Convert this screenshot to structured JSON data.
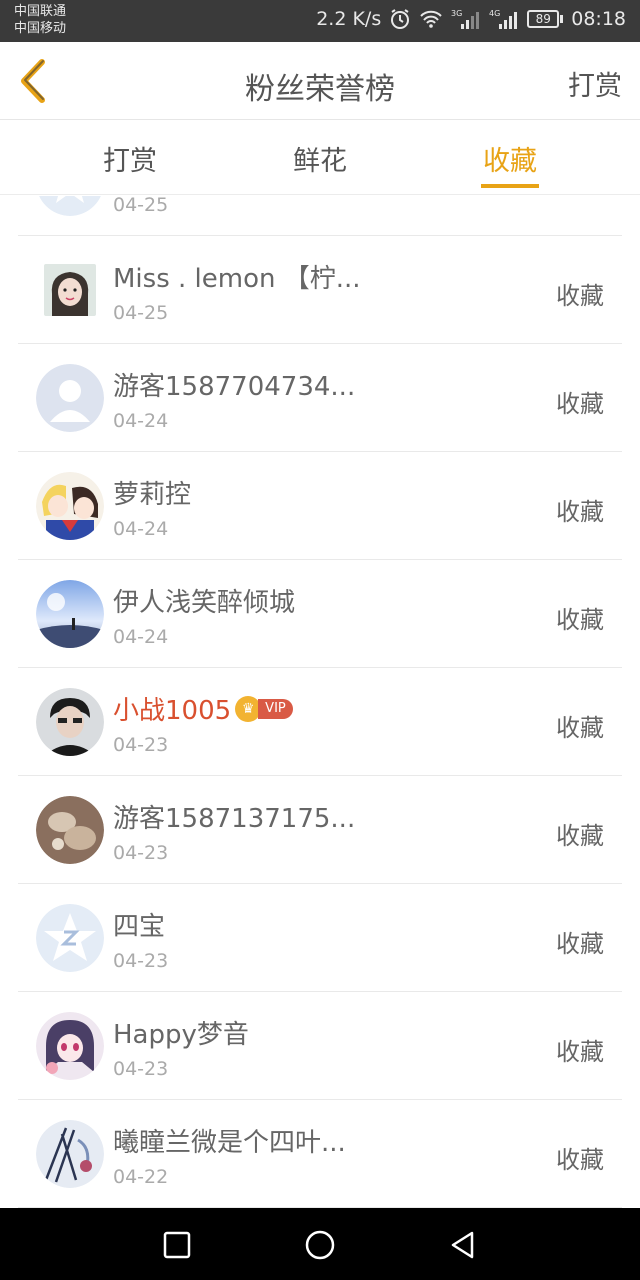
{
  "status_bar": {
    "carrier1": "中国联通",
    "carrier2": "中国移动",
    "speed": "2.2 K/s",
    "net1": "3G",
    "net2": "4G",
    "battery": "89",
    "time": "08:18"
  },
  "header": {
    "title": "粉丝荣誉榜",
    "action": "打赏"
  },
  "tabs": [
    {
      "label": "打赏",
      "active": false
    },
    {
      "label": "鲜花",
      "active": false
    },
    {
      "label": "收藏",
      "active": true
    }
  ],
  "colors": {
    "accent": "#e8a316",
    "vip_name": "#d9502f"
  },
  "list": {
    "partial_date": "04-25",
    "rows": [
      {
        "name": "Miss . lemon 【柠...",
        "date": "04-25",
        "action": "收藏",
        "avatar": "girl-photo"
      },
      {
        "name": "游客1587704734...",
        "date": "04-24",
        "action": "收藏",
        "avatar": "default-user"
      },
      {
        "name": "萝莉控",
        "date": "04-24",
        "action": "收藏",
        "avatar": "anime-girls"
      },
      {
        "name": "伊人浅笑醉倾城",
        "date": "04-24",
        "action": "收藏",
        "avatar": "sky-scene"
      },
      {
        "name": "小战1005",
        "date": "04-23",
        "action": "收藏",
        "avatar": "boy-photo",
        "vip": "VIP"
      },
      {
        "name": "游客1587137175...",
        "date": "04-23",
        "action": "收藏",
        "avatar": "food-photo"
      },
      {
        "name": "四宝",
        "date": "04-23",
        "action": "收藏",
        "avatar": "qq-star"
      },
      {
        "name": "Happy梦音",
        "date": "04-23",
        "action": "收藏",
        "avatar": "anime-portrait"
      },
      {
        "name": "曦瞳兰微是个四叶...",
        "date": "04-22",
        "action": "收藏",
        "avatar": "anime-sketch"
      }
    ]
  }
}
